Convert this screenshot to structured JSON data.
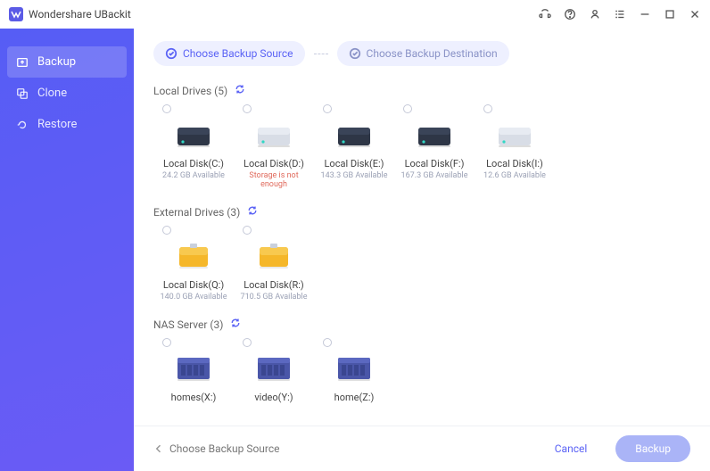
{
  "titlebar": {
    "app_name": "Wondershare UBackit"
  },
  "sidebar": {
    "items": [
      {
        "label": "Backup"
      },
      {
        "label": "Clone"
      },
      {
        "label": "Restore"
      }
    ]
  },
  "steps": {
    "source": "Choose Backup Source",
    "destination": "Choose Backup Destination"
  },
  "sections": {
    "local": {
      "title": "Local Drives (5)"
    },
    "external": {
      "title": "External Drives (3)"
    },
    "nas": {
      "title": "NAS Server (3)"
    }
  },
  "local_drives": [
    {
      "label": "Local Disk(C:)",
      "sub": "24.2 GB Available",
      "warn": false,
      "color": "dark"
    },
    {
      "label": "Local Disk(D:)",
      "sub": "Storage is not enough",
      "warn": true,
      "color": "light"
    },
    {
      "label": "Local Disk(E:)",
      "sub": "143.3 GB Available",
      "warn": false,
      "color": "dark"
    },
    {
      "label": "Local Disk(F:)",
      "sub": "167.3 GB Available",
      "warn": false,
      "color": "dark"
    },
    {
      "label": "Local Disk(I:)",
      "sub": "12.6 GB Available",
      "warn": false,
      "color": "light"
    }
  ],
  "external_drives": [
    {
      "label": "Local Disk(Q:)",
      "sub": "140.0 GB Available"
    },
    {
      "label": "Local Disk(R:)",
      "sub": "710.5 GB Available"
    }
  ],
  "nas_drives": [
    {
      "label": "homes(X:)"
    },
    {
      "label": "video(Y:)"
    },
    {
      "label": "home(Z:)"
    }
  ],
  "footer": {
    "hint": "Choose Backup Source",
    "cancel": "Cancel",
    "backup": "Backup"
  }
}
